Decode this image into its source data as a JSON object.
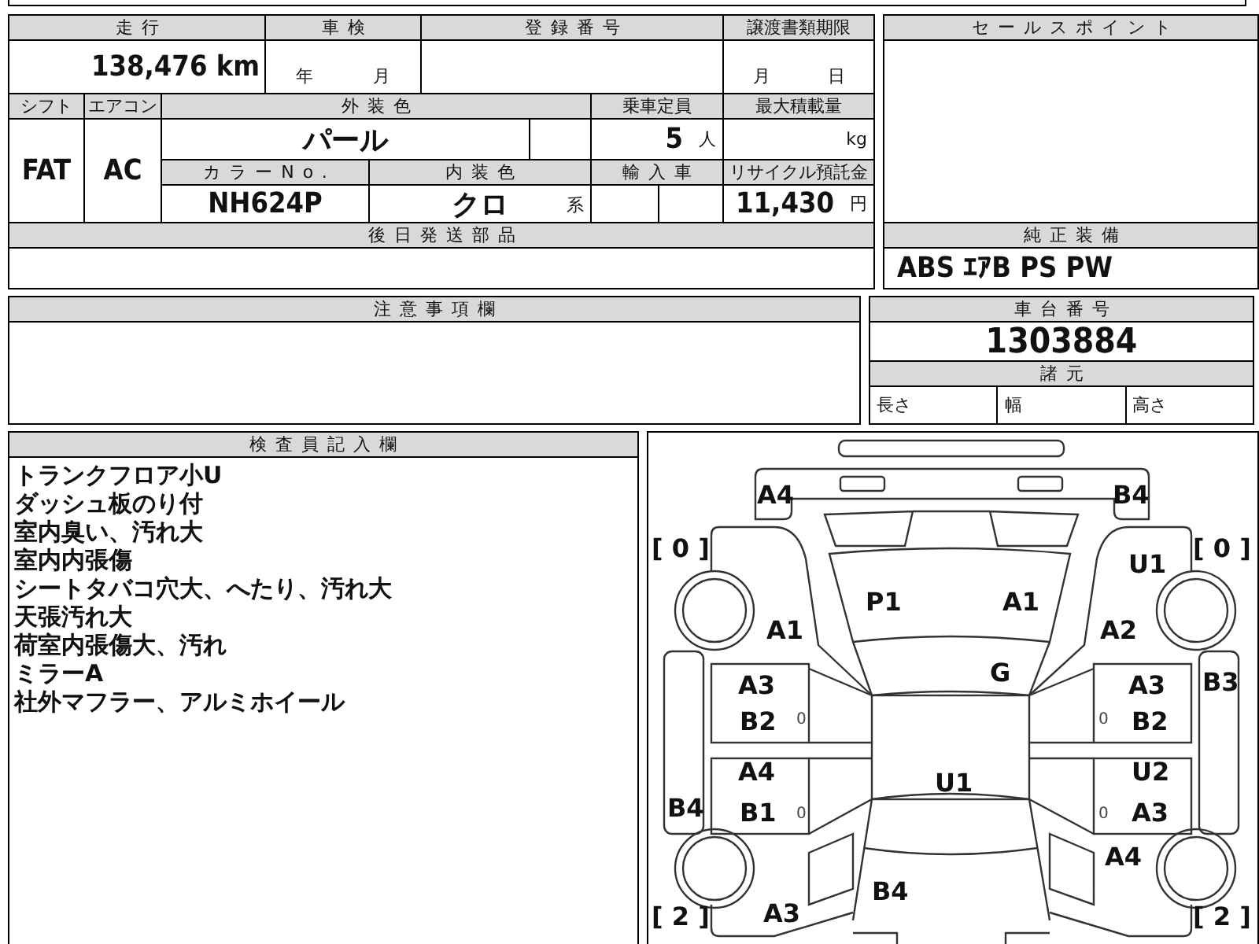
{
  "vehicle_info": {
    "mileage": {
      "label": "走行",
      "value": "138,476",
      "unit": "km"
    },
    "inspection": {
      "label": "車検",
      "year_unit": "年",
      "month_unit": "月"
    },
    "registration_number": {
      "label": "登録番号"
    },
    "transfer_deadline": {
      "label": "譲渡書類期限",
      "month_unit": "月",
      "day_unit": "日"
    },
    "shift": {
      "label": "シフト",
      "value": "FAT"
    },
    "air_conditioner": {
      "label": "エアコン",
      "value": "AC"
    },
    "exterior_color": {
      "label": "外装色",
      "value": "パール"
    },
    "capacity": {
      "label": "乗車定員",
      "value": "5",
      "unit": "人"
    },
    "max_load": {
      "label": "最大積載量",
      "unit": "kg"
    },
    "color_no": {
      "label": "カラーNo.",
      "value": "NH624P"
    },
    "interior_color": {
      "label": "内装色",
      "value": "クロ",
      "unit": "系"
    },
    "imported": {
      "label": "輸入車"
    },
    "recycle_deposit": {
      "label": "リサイクル預託金",
      "value": "11,430",
      "unit": "円"
    },
    "parts_to_send": {
      "label": "後日発送部品"
    }
  },
  "sales_points": {
    "label": "セールスポイント"
  },
  "standard_equipment": {
    "label": "純正装備",
    "value": "ABS ｴｱB PS PW"
  },
  "notes": {
    "label": "注意事項欄"
  },
  "chassis_number": {
    "label": "車台番号",
    "value": "1303884"
  },
  "specs": {
    "label": "諸元",
    "items": [
      "長さ",
      "幅",
      "高さ"
    ]
  },
  "inspector_notes": {
    "label": "検査員記入欄",
    "lines": [
      "トランクフロア小U",
      "ダッシュ板のり付",
      "室内臭い、汚れ大",
      "室内内張傷",
      "シートタバコ穴大、へたり、汚れ大",
      "天張汚れ大",
      "荷室内張傷大、汚れ",
      "ミラーA",
      "社外マフラー、アルミホイール"
    ]
  },
  "damage_map": {
    "marks": [
      {
        "kind": "damage",
        "text": "A4"
      },
      {
        "kind": "damage",
        "text": "B4"
      },
      {
        "kind": "tread",
        "text": "[ 0 ]"
      },
      {
        "kind": "tread",
        "text": "[ 0 ]"
      },
      {
        "kind": "damage",
        "text": "U1"
      },
      {
        "kind": "damage",
        "text": "P1"
      },
      {
        "kind": "damage",
        "text": "A1"
      },
      {
        "kind": "damage",
        "text": "A1"
      },
      {
        "kind": "damage",
        "text": "A2"
      },
      {
        "kind": "damage",
        "text": "G"
      },
      {
        "kind": "damage",
        "text": "A3"
      },
      {
        "kind": "damage",
        "text": "A3"
      },
      {
        "kind": "damage",
        "text": "B3"
      },
      {
        "kind": "damage",
        "text": "B2"
      },
      {
        "kind": "small",
        "text": "0"
      },
      {
        "kind": "small",
        "text": "0"
      },
      {
        "kind": "damage",
        "text": "B2"
      },
      {
        "kind": "damage",
        "text": "A4"
      },
      {
        "kind": "damage",
        "text": "U1"
      },
      {
        "kind": "damage",
        "text": "U2"
      },
      {
        "kind": "damage",
        "text": "B4"
      },
      {
        "kind": "damage",
        "text": "B1"
      },
      {
        "kind": "small",
        "text": "0"
      },
      {
        "kind": "small",
        "text": "0"
      },
      {
        "kind": "damage",
        "text": "A3"
      },
      {
        "kind": "damage",
        "text": "A4"
      },
      {
        "kind": "damage",
        "text": "B4"
      },
      {
        "kind": "tread",
        "text": "[ 2 ]"
      },
      {
        "kind": "damage",
        "text": "A3"
      },
      {
        "kind": "tread",
        "text": "[ 2 ]"
      }
    ]
  }
}
